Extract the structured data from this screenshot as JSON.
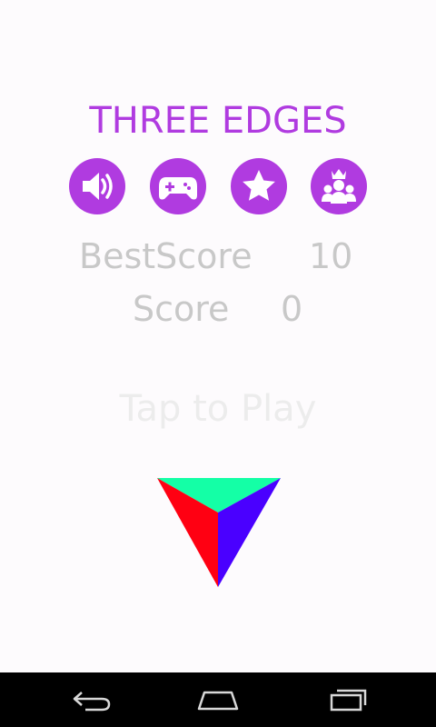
{
  "game": {
    "title": "THREE EDGES",
    "tap_prompt": "Tap to Play"
  },
  "scores": {
    "best_label": "BestScore",
    "best_value": "10",
    "current_label": "Score",
    "current_value": "0"
  },
  "icons": [
    "speaker-icon",
    "gamepad-icon",
    "star-icon",
    "leaderboard-icon"
  ],
  "colors": {
    "accent": "#b03be0",
    "score_text": "#c8c8c8",
    "tap_text": "#ececec",
    "pyramid_top": "#14ffa6",
    "pyramid_left": "#ff0012",
    "pyramid_right": "#4a00ff"
  }
}
